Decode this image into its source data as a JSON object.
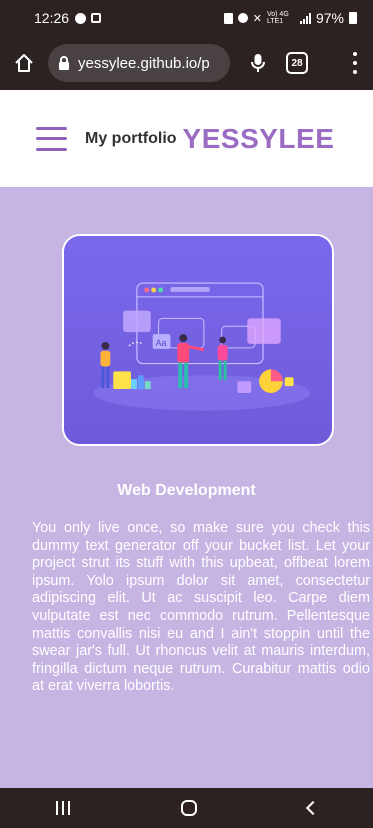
{
  "status_bar": {
    "time": "12:26",
    "network_label": "Vo) 4G LTE1",
    "battery": "97%"
  },
  "browser": {
    "url": "yessylee.github.io/p",
    "tab_count": "28"
  },
  "site": {
    "brand_small": "My portfolio",
    "brand_big": "YESSYLEE",
    "accent_color": "#9b6cc4",
    "background_color": "#c6b4e3"
  },
  "card": {
    "title": "Web Development",
    "text": "You only live once, so make sure you check this dummy text generator off your bucket list. Let your project strut its stuff with this upbeat, offbeat lorem ipsum. Yolo ipsum dolor sit amet, consectetur adipiscing elit. Ut ac suscipit leo. Carpe diem vulputate est nec commodo rutrum. Pellentesque mattis convallis nisi eu and I ain't stoppin until the swear jar's full. Ut rhoncus velit at mauris interdum, fringilla dictum neque rutrum. Curabitur mattis odio at erat viverra lobortis.",
    "illustration_label": "Aa"
  },
  "icons": {
    "home": "home-icon",
    "lock": "lock-icon",
    "mic": "microphone-icon",
    "menu": "more-vert-icon"
  }
}
